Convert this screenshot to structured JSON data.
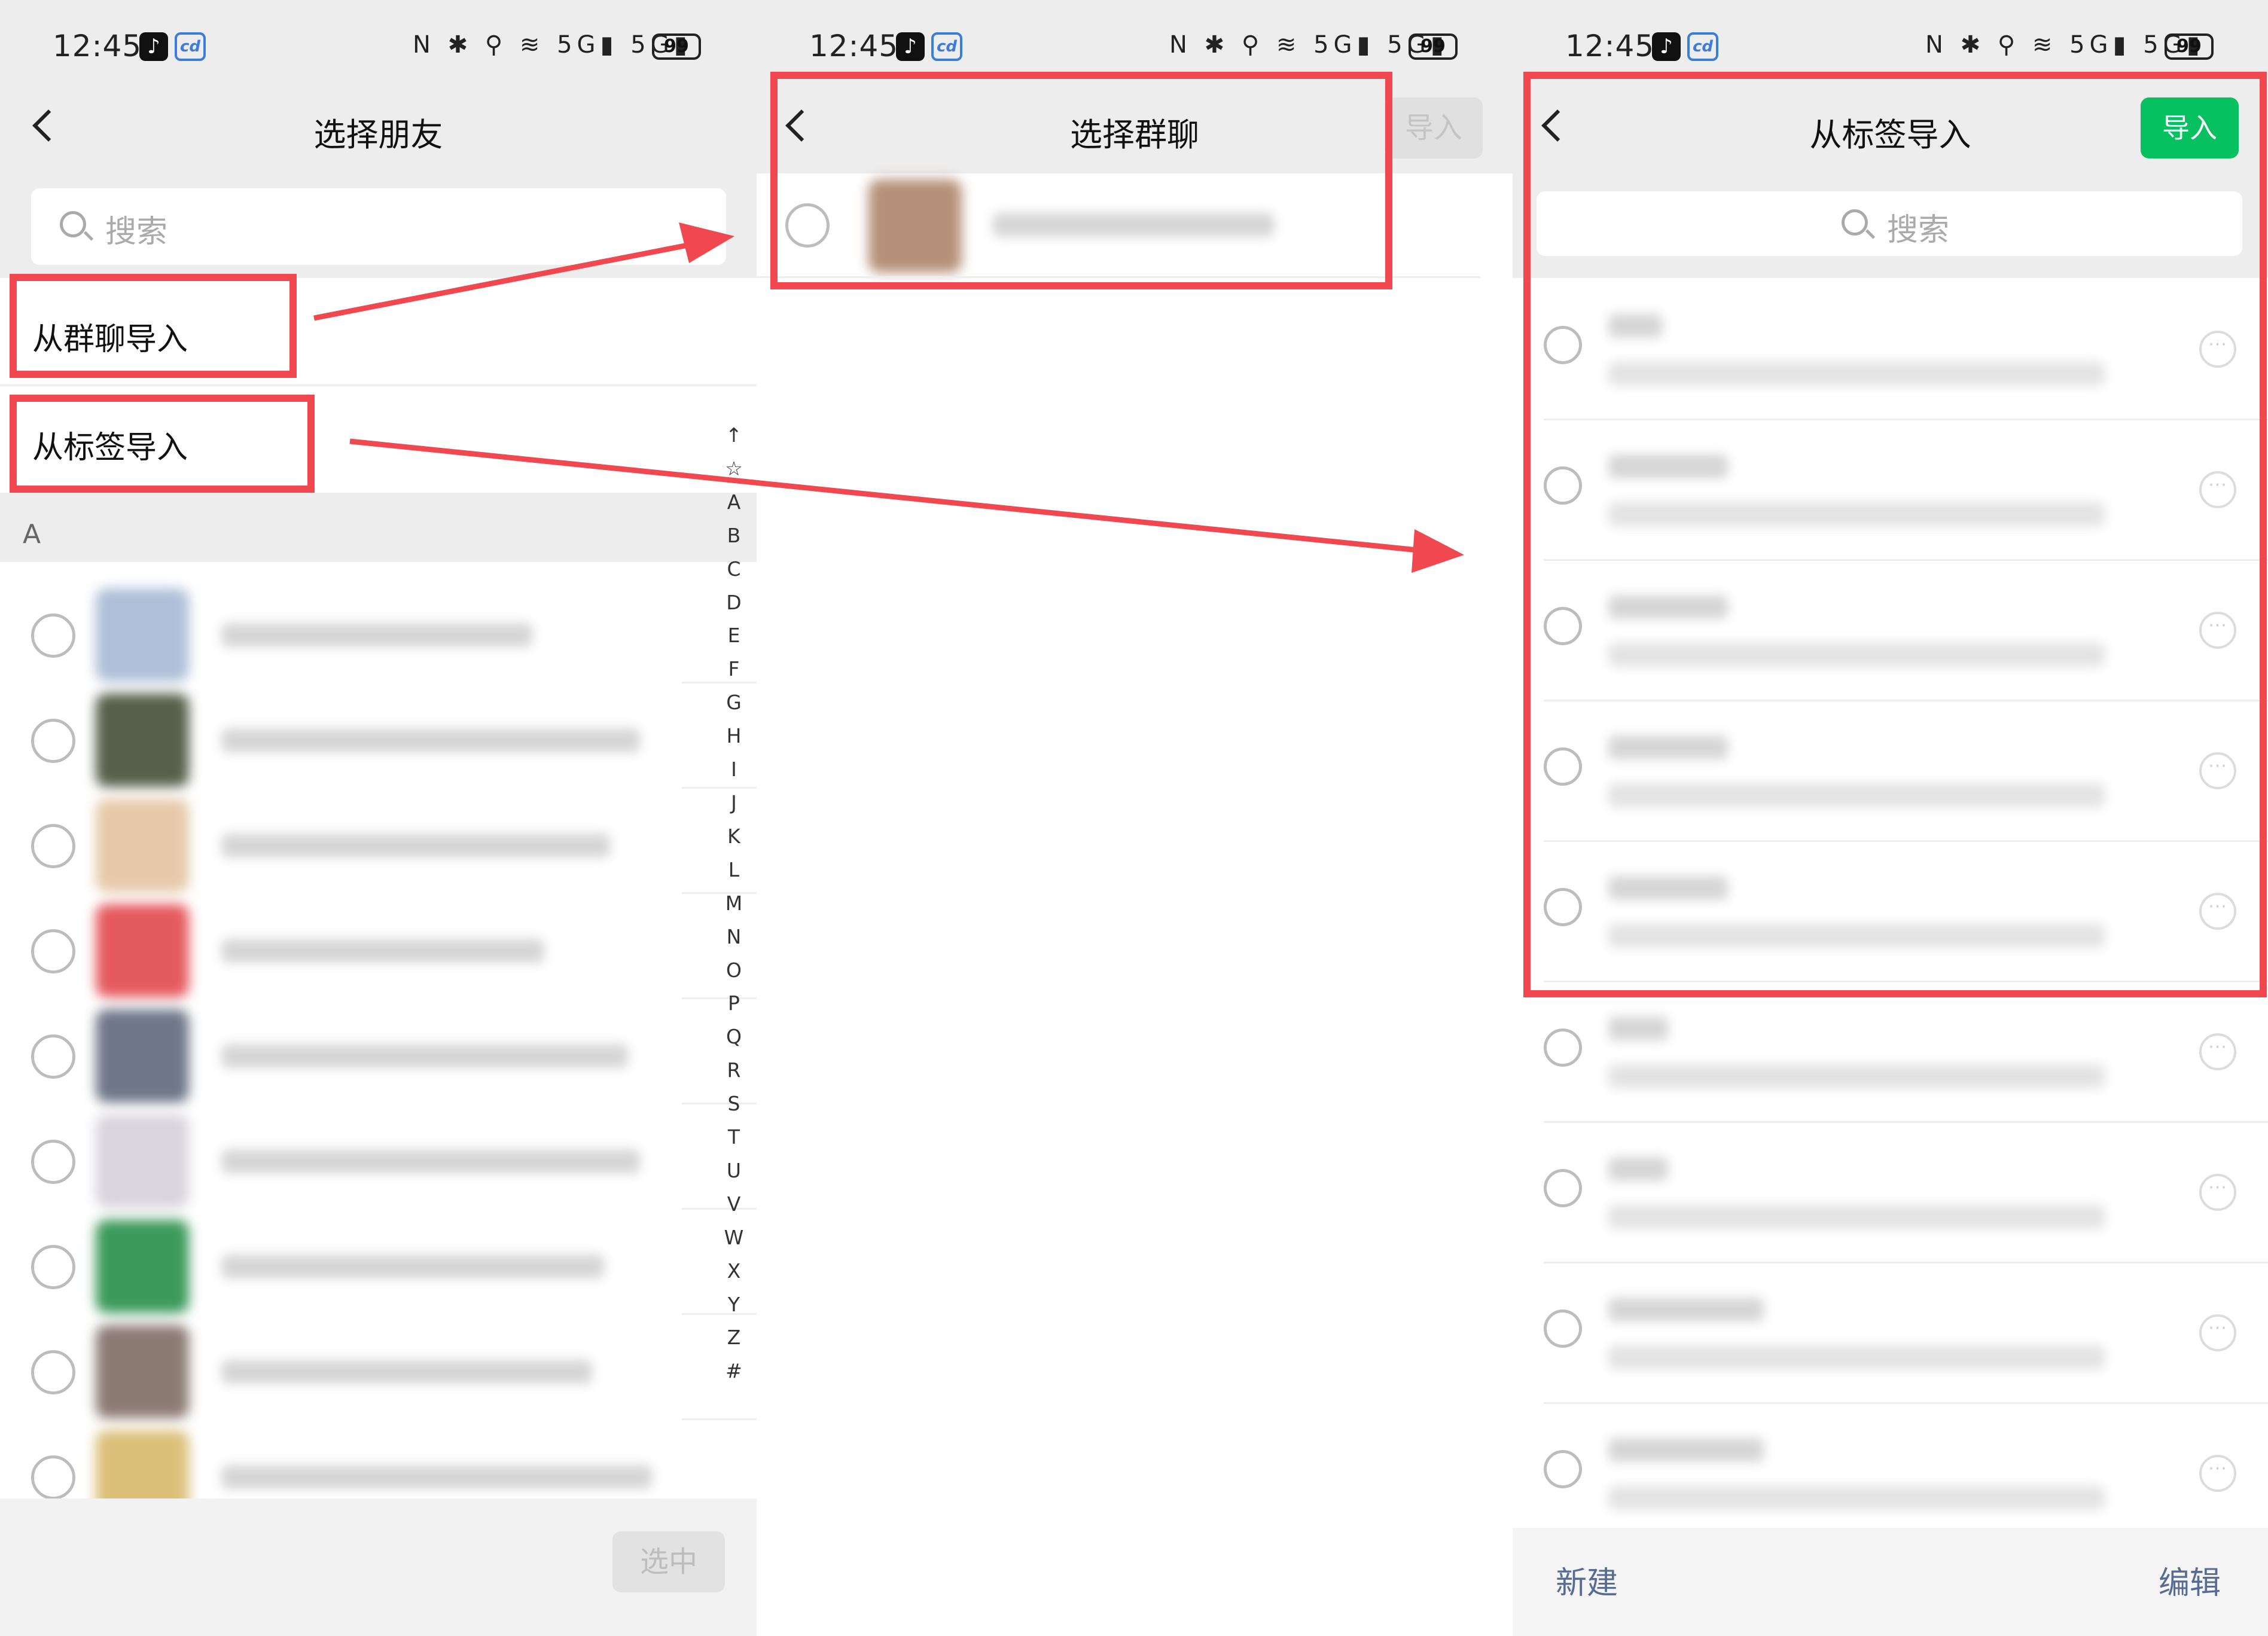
{
  "status_bar": {
    "time": "12:45",
    "battery": "99",
    "right_icons": "N ✱ ⚲ ≋ 5G▮ 5G▮"
  },
  "panel_select_friends": {
    "title": "选择朋友",
    "search_placeholder": "搜索",
    "options": [
      "从群聊导入",
      "从标签导入"
    ],
    "section_letter": "A",
    "index_letters": [
      "↑",
      "☆",
      "A",
      "B",
      "C",
      "D",
      "E",
      "F",
      "G",
      "H",
      "I",
      "J",
      "K",
      "L",
      "M",
      "N",
      "O",
      "P",
      "Q",
      "R",
      "S",
      "T",
      "U",
      "V",
      "W",
      "X",
      "Y",
      "Z",
      "#"
    ],
    "confirm_button": "选中"
  },
  "panel_select_group": {
    "title": "选择群聊",
    "import_button": "导入"
  },
  "panel_import_by_tag": {
    "title": "从标签导入",
    "import_button": "导入",
    "search_placeholder": "搜索",
    "bottom_new": "新建",
    "bottom_edit": "编辑"
  },
  "colors": {
    "highlight": "#f0484e",
    "primary_green": "#07c160",
    "link_blue": "#576b95",
    "avatar_palette": [
      "#aebfd8",
      "#56604a",
      "#e6c9a9",
      "#e55a5e",
      "#6e7789",
      "#d9d4dd",
      "#3b9a5b",
      "#8c7b73",
      "#dcc07a"
    ]
  }
}
